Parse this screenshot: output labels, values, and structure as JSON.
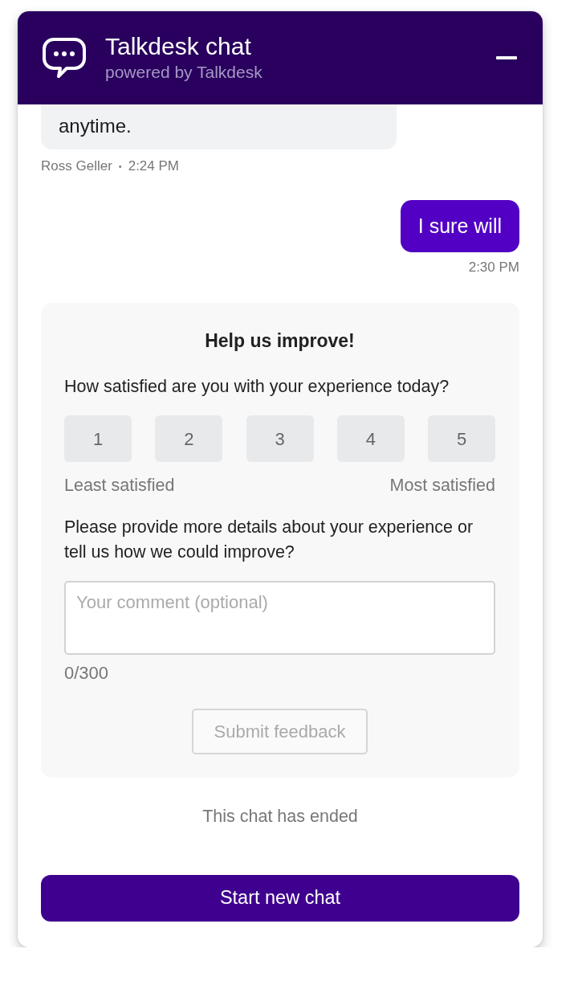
{
  "header": {
    "title": "Talkdesk chat",
    "subtitle": "powered by Talkdesk"
  },
  "messages": [
    {
      "kind": "agent",
      "text": "anytime.",
      "author": "Ross Geller",
      "separator": "•",
      "time": "2:24 PM"
    },
    {
      "kind": "visitor",
      "text": "I sure will",
      "time": "2:30 PM"
    }
  ],
  "survey": {
    "title": "Help us improve!",
    "question": "How satisfied are you with your experience today?",
    "ratings": [
      {
        "label": "1",
        "selected": false
      },
      {
        "label": "2",
        "selected": false
      },
      {
        "label": "3",
        "selected": false
      },
      {
        "label": "4",
        "selected": false
      },
      {
        "label": "5",
        "selected": false
      }
    ],
    "scale_low": "Least satisfied",
    "scale_high": "Most satisfied",
    "details_prompt": "Please provide more details about your experience or tell us how we could improve?",
    "comment": {
      "placeholder": "Your comment (optional)"
    },
    "counter": "0/300",
    "submit": {
      "label": "Submit feedback",
      "disabled": true
    }
  },
  "status": "This chat has ended",
  "start_button": {
    "label": "Start new chat"
  }
}
